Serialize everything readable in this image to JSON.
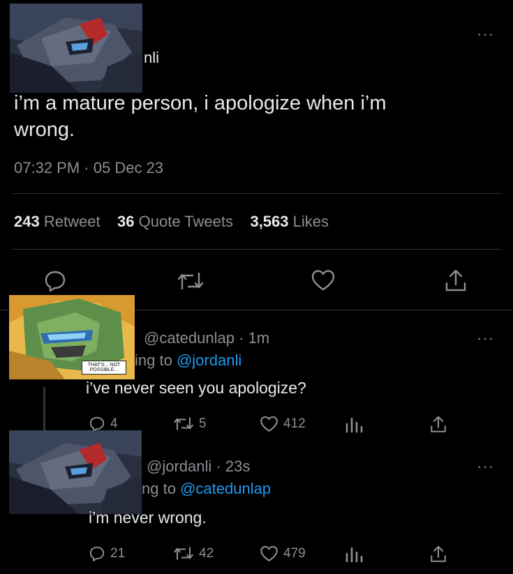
{
  "main_tweet": {
    "handle_fragment": "nli",
    "text_line1": "i’m a mature person, i apologize when i’m",
    "text_line2": "wrong.",
    "time": "07:32 PM",
    "sep": "·",
    "date": "05 Dec 23",
    "stats": {
      "retweets": "243",
      "retweets_label": "Retweet",
      "quotes": "36",
      "quotes_label": "Quote Tweets",
      "likes": "3,563",
      "likes_label": "Likes"
    },
    "more": "···"
  },
  "reply1": {
    "handle": "@catedunlap",
    "sep": "·",
    "age": "1m",
    "replying_fragment": "ing to",
    "replying_target": "@jordanli",
    "text": "i’ve never seen you apologize?",
    "avatar_caption": "THAT'S... NOT POSSIBLE...",
    "counts": {
      "replies": "4",
      "retweets": "5",
      "likes": "412"
    },
    "more": "···"
  },
  "reply2": {
    "handle": "@jordanli",
    "sep": "·",
    "age": "23s",
    "replying_fragment": "ng to",
    "replying_target": "@catedunlap",
    "text": "i’m never wrong.",
    "counts": {
      "replies": "21",
      "retweets": "42",
      "likes": "479"
    },
    "more": "···"
  },
  "colors": {
    "background": "#000000",
    "text": "#e7e9ea",
    "secondary": "#8b8f94",
    "link": "#1d9bf0",
    "divider": "#2f3336"
  },
  "icons": [
    "reply-icon",
    "retweet-icon",
    "like-icon",
    "share-icon",
    "analytics-icon",
    "more-icon"
  ]
}
